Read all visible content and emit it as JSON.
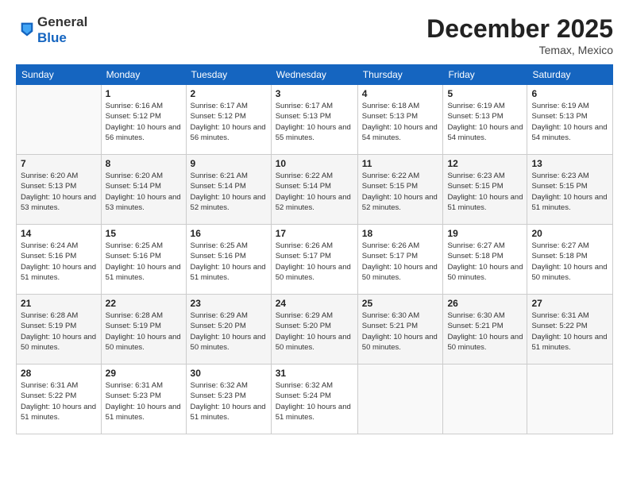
{
  "logo": {
    "line1": "General",
    "line2": "Blue"
  },
  "header": {
    "month": "December 2025",
    "location": "Temax, Mexico"
  },
  "days_of_week": [
    "Sunday",
    "Monday",
    "Tuesday",
    "Wednesday",
    "Thursday",
    "Friday",
    "Saturday"
  ],
  "weeks": [
    [
      {
        "day": "",
        "info": ""
      },
      {
        "day": "1",
        "info": "Sunrise: 6:16 AM\nSunset: 5:12 PM\nDaylight: 10 hours and 56 minutes."
      },
      {
        "day": "2",
        "info": "Sunrise: 6:17 AM\nSunset: 5:12 PM\nDaylight: 10 hours and 56 minutes."
      },
      {
        "day": "3",
        "info": "Sunrise: 6:17 AM\nSunset: 5:13 PM\nDaylight: 10 hours and 55 minutes."
      },
      {
        "day": "4",
        "info": "Sunrise: 6:18 AM\nSunset: 5:13 PM\nDaylight: 10 hours and 54 minutes."
      },
      {
        "day": "5",
        "info": "Sunrise: 6:19 AM\nSunset: 5:13 PM\nDaylight: 10 hours and 54 minutes."
      },
      {
        "day": "6",
        "info": "Sunrise: 6:19 AM\nSunset: 5:13 PM\nDaylight: 10 hours and 54 minutes."
      }
    ],
    [
      {
        "day": "7",
        "info": "Sunrise: 6:20 AM\nSunset: 5:13 PM\nDaylight: 10 hours and 53 minutes."
      },
      {
        "day": "8",
        "info": "Sunrise: 6:20 AM\nSunset: 5:14 PM\nDaylight: 10 hours and 53 minutes."
      },
      {
        "day": "9",
        "info": "Sunrise: 6:21 AM\nSunset: 5:14 PM\nDaylight: 10 hours and 52 minutes."
      },
      {
        "day": "10",
        "info": "Sunrise: 6:22 AM\nSunset: 5:14 PM\nDaylight: 10 hours and 52 minutes."
      },
      {
        "day": "11",
        "info": "Sunrise: 6:22 AM\nSunset: 5:15 PM\nDaylight: 10 hours and 52 minutes."
      },
      {
        "day": "12",
        "info": "Sunrise: 6:23 AM\nSunset: 5:15 PM\nDaylight: 10 hours and 51 minutes."
      },
      {
        "day": "13",
        "info": "Sunrise: 6:23 AM\nSunset: 5:15 PM\nDaylight: 10 hours and 51 minutes."
      }
    ],
    [
      {
        "day": "14",
        "info": "Sunrise: 6:24 AM\nSunset: 5:16 PM\nDaylight: 10 hours and 51 minutes."
      },
      {
        "day": "15",
        "info": "Sunrise: 6:25 AM\nSunset: 5:16 PM\nDaylight: 10 hours and 51 minutes."
      },
      {
        "day": "16",
        "info": "Sunrise: 6:25 AM\nSunset: 5:16 PM\nDaylight: 10 hours and 51 minutes."
      },
      {
        "day": "17",
        "info": "Sunrise: 6:26 AM\nSunset: 5:17 PM\nDaylight: 10 hours and 50 minutes."
      },
      {
        "day": "18",
        "info": "Sunrise: 6:26 AM\nSunset: 5:17 PM\nDaylight: 10 hours and 50 minutes."
      },
      {
        "day": "19",
        "info": "Sunrise: 6:27 AM\nSunset: 5:18 PM\nDaylight: 10 hours and 50 minutes."
      },
      {
        "day": "20",
        "info": "Sunrise: 6:27 AM\nSunset: 5:18 PM\nDaylight: 10 hours and 50 minutes."
      }
    ],
    [
      {
        "day": "21",
        "info": "Sunrise: 6:28 AM\nSunset: 5:19 PM\nDaylight: 10 hours and 50 minutes."
      },
      {
        "day": "22",
        "info": "Sunrise: 6:28 AM\nSunset: 5:19 PM\nDaylight: 10 hours and 50 minutes."
      },
      {
        "day": "23",
        "info": "Sunrise: 6:29 AM\nSunset: 5:20 PM\nDaylight: 10 hours and 50 minutes."
      },
      {
        "day": "24",
        "info": "Sunrise: 6:29 AM\nSunset: 5:20 PM\nDaylight: 10 hours and 50 minutes."
      },
      {
        "day": "25",
        "info": "Sunrise: 6:30 AM\nSunset: 5:21 PM\nDaylight: 10 hours and 50 minutes."
      },
      {
        "day": "26",
        "info": "Sunrise: 6:30 AM\nSunset: 5:21 PM\nDaylight: 10 hours and 50 minutes."
      },
      {
        "day": "27",
        "info": "Sunrise: 6:31 AM\nSunset: 5:22 PM\nDaylight: 10 hours and 51 minutes."
      }
    ],
    [
      {
        "day": "28",
        "info": "Sunrise: 6:31 AM\nSunset: 5:22 PM\nDaylight: 10 hours and 51 minutes."
      },
      {
        "day": "29",
        "info": "Sunrise: 6:31 AM\nSunset: 5:23 PM\nDaylight: 10 hours and 51 minutes."
      },
      {
        "day": "30",
        "info": "Sunrise: 6:32 AM\nSunset: 5:23 PM\nDaylight: 10 hours and 51 minutes."
      },
      {
        "day": "31",
        "info": "Sunrise: 6:32 AM\nSunset: 5:24 PM\nDaylight: 10 hours and 51 minutes."
      },
      {
        "day": "",
        "info": ""
      },
      {
        "day": "",
        "info": ""
      },
      {
        "day": "",
        "info": ""
      }
    ]
  ]
}
